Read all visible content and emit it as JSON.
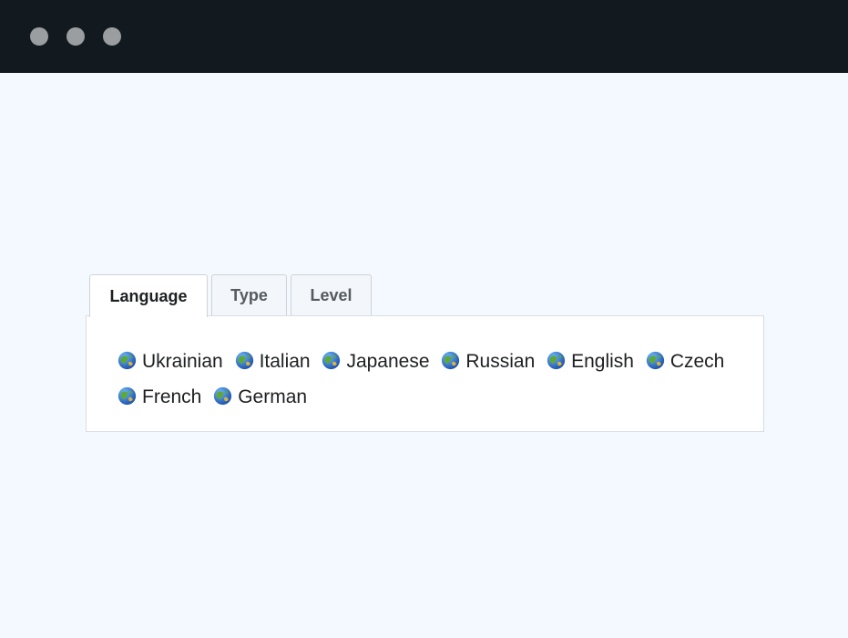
{
  "window": {
    "controls": [
      "close",
      "minimize",
      "maximize"
    ]
  },
  "tabs": [
    {
      "label": "Language",
      "active": true
    },
    {
      "label": "Type",
      "active": false
    },
    {
      "label": "Level",
      "active": false
    }
  ],
  "languages": {
    "icon": "globe-asia-icon",
    "items": [
      "Ukrainian",
      "Italian",
      "Japanese",
      "Russian",
      "English",
      "Czech",
      "French",
      "German"
    ]
  },
  "colors": {
    "titlebar": "#121a20",
    "window_dot": "#9a9ea1",
    "page_background": "#f4f9ff",
    "panel_background": "#ffffff"
  }
}
